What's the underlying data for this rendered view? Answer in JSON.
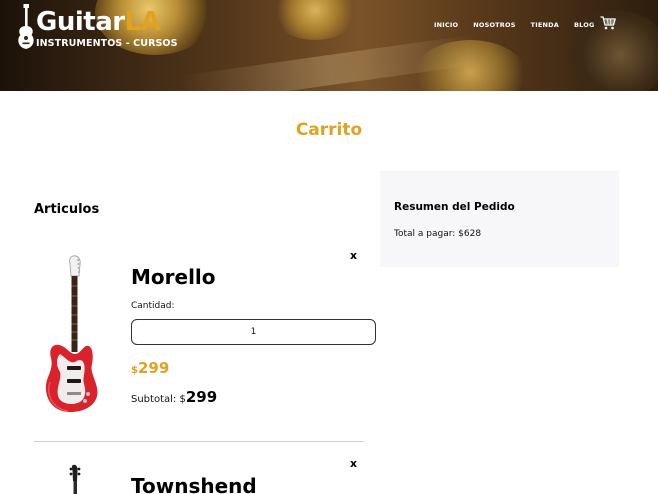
{
  "brand": {
    "name_main": "Guitar",
    "name_accent": "LA",
    "tagline": "INSTRUMENTOS - CURSOS",
    "accent_color": "#e0a320"
  },
  "nav": {
    "items": [
      {
        "label": "INICIO"
      },
      {
        "label": "NOSOTROS"
      },
      {
        "label": "TIENDA"
      },
      {
        "label": "BLOG"
      }
    ],
    "cart_icon": "cart-icon"
  },
  "page": {
    "title": "Carrito",
    "section_title": "Articulos"
  },
  "cart_items": [
    {
      "name": "Morello",
      "remove_label": "x",
      "quantity_label": "Cantidad:",
      "quantity_value": "1",
      "price_currency": "$",
      "price": "299",
      "subtotal_label": "Subtotal: ",
      "subtotal_currency": "$",
      "subtotal": "299",
      "image_icon": "red-electric-guitar-icon"
    },
    {
      "name": "Townshend",
      "remove_label": "x",
      "image_icon": "black-electric-guitar-icon"
    }
  ],
  "summary": {
    "title": "Resumen del Pedido",
    "total_label": "Total a pagar: $628"
  }
}
